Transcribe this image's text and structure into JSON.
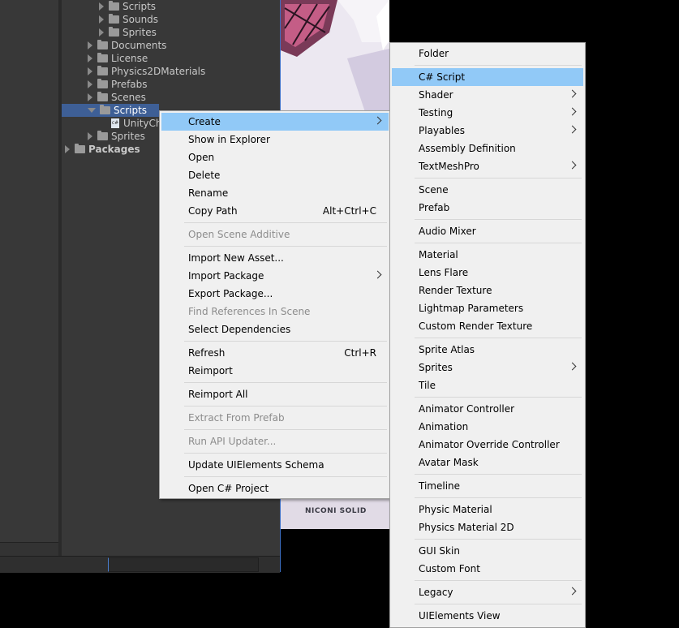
{
  "project_tree": {
    "items": [
      {
        "label": "Scripts"
      },
      {
        "label": "Sounds"
      },
      {
        "label": "Sprites"
      },
      {
        "label": "Documents"
      },
      {
        "label": "License"
      },
      {
        "label": "Physics2DMaterials"
      },
      {
        "label": "Prefabs"
      },
      {
        "label": "Scenes"
      },
      {
        "label": "Scripts"
      },
      {
        "label": "UnityCh"
      },
      {
        "label": "Sprites"
      },
      {
        "label": "Packages"
      }
    ],
    "selected_index": 8
  },
  "scene_view": {
    "footer_text": "NICONI SOLID"
  },
  "context_menu": {
    "items": [
      {
        "label": "Create",
        "highlighted": true
      },
      {
        "label": "Show in Explorer"
      },
      {
        "label": "Open"
      },
      {
        "label": "Delete"
      },
      {
        "label": "Rename"
      },
      {
        "label": "Copy Path",
        "shortcut": "Alt+Ctrl+C"
      },
      {
        "label": "Open Scene Additive",
        "disabled": true
      },
      {
        "label": "Import New Asset..."
      },
      {
        "label": "Import Package"
      },
      {
        "label": "Export Package..."
      },
      {
        "label": "Find References In Scene",
        "disabled": true
      },
      {
        "label": "Select Dependencies"
      },
      {
        "label": "Refresh",
        "shortcut": "Ctrl+R"
      },
      {
        "label": "Reimport"
      },
      {
        "label": "Reimport All"
      },
      {
        "label": "Extract From Prefab",
        "disabled": true
      },
      {
        "label": "Run API Updater...",
        "disabled": true
      },
      {
        "label": "Update UIElements Schema"
      },
      {
        "label": "Open C# Project"
      }
    ]
  },
  "create_submenu": {
    "items": [
      {
        "label": "Folder"
      },
      {
        "label": "C# Script",
        "highlighted": true
      },
      {
        "label": "Shader"
      },
      {
        "label": "Testing"
      },
      {
        "label": "Playables"
      },
      {
        "label": "Assembly Definition"
      },
      {
        "label": "TextMeshPro"
      },
      {
        "label": "Scene"
      },
      {
        "label": "Prefab"
      },
      {
        "label": "Audio Mixer"
      },
      {
        "label": "Material"
      },
      {
        "label": "Lens Flare"
      },
      {
        "label": "Render Texture"
      },
      {
        "label": "Lightmap Parameters"
      },
      {
        "label": "Custom Render Texture"
      },
      {
        "label": "Sprite Atlas"
      },
      {
        "label": "Sprites"
      },
      {
        "label": "Tile"
      },
      {
        "label": "Animator Controller"
      },
      {
        "label": "Animation"
      },
      {
        "label": "Animator Override Controller"
      },
      {
        "label": "Avatar Mask"
      },
      {
        "label": "Timeline"
      },
      {
        "label": "Physic Material"
      },
      {
        "label": "Physics Material 2D"
      },
      {
        "label": "GUI Skin"
      },
      {
        "label": "Custom Font"
      },
      {
        "label": "Legacy"
      },
      {
        "label": "UIElements View"
      }
    ]
  },
  "colors": {
    "menu_background": "#f0f0f0",
    "menu_highlight": "#91c9f7",
    "tree_selection": "#3e5f96",
    "panel_background": "#383838"
  }
}
